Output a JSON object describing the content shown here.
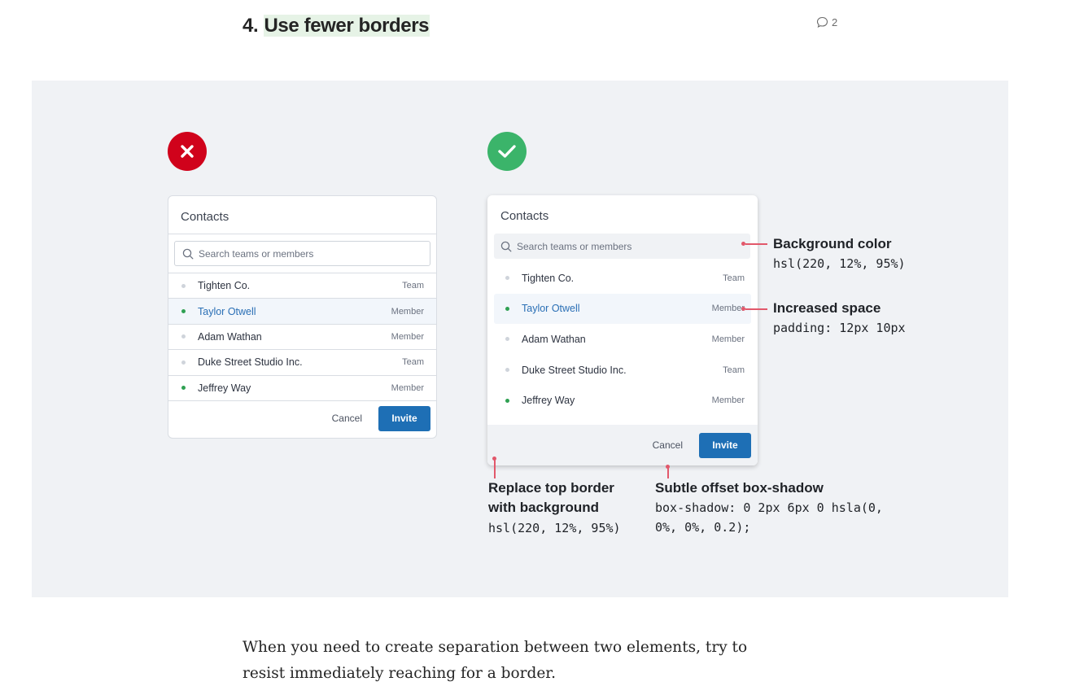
{
  "article": {
    "heading_number": "4.",
    "heading_text": "Use fewer borders",
    "comment_count": "2",
    "paragraph": "When you need to create separation between two elements, try to resist immediately reaching for a border."
  },
  "colors": {
    "bad_badge": "#d0021b",
    "good_badge": "#3bb46a",
    "invite_button": "#1e6fb5",
    "annotation": "#e2586b",
    "figure_background": "#f0f2f5"
  },
  "bad_card": {
    "title": "Contacts",
    "search_placeholder": "Search teams or members",
    "rows": [
      {
        "name": "Tighten Co.",
        "type": "Team"
      },
      {
        "name": "Taylor Otwell",
        "type": "Member"
      },
      {
        "name": "Adam Wathan",
        "type": "Member"
      },
      {
        "name": "Duke Street Studio Inc.",
        "type": "Team"
      },
      {
        "name": "Jeffrey Way",
        "type": "Member"
      }
    ],
    "cancel_label": "Cancel",
    "invite_label": "Invite"
  },
  "good_card": {
    "title": "Contacts",
    "search_placeholder": "Search teams or members",
    "rows": [
      {
        "name": "Tighten Co.",
        "type": "Team"
      },
      {
        "name": "Taylor Otwell",
        "type": "Member"
      },
      {
        "name": "Adam Wathan",
        "type": "Member"
      },
      {
        "name": "Duke Street Studio Inc.",
        "type": "Team"
      },
      {
        "name": "Jeffrey Way",
        "type": "Member"
      }
    ],
    "cancel_label": "Cancel",
    "invite_label": "Invite"
  },
  "annotations": {
    "bg_title": "Background color",
    "bg_code": "hsl(220, 12%, 95%)",
    "space_title": "Increased space",
    "space_code": "padding: 12px 10px",
    "replace_title_1": "Replace top border",
    "replace_title_2": "with background",
    "replace_code": "hsl(220, 12%, 95%)",
    "shadow_title": "Subtle offset box-shadow",
    "shadow_code_1": "box-shadow: 0 2px 6px 0 hsla(0,",
    "shadow_code_2": "0%, 0%, 0.2);"
  }
}
